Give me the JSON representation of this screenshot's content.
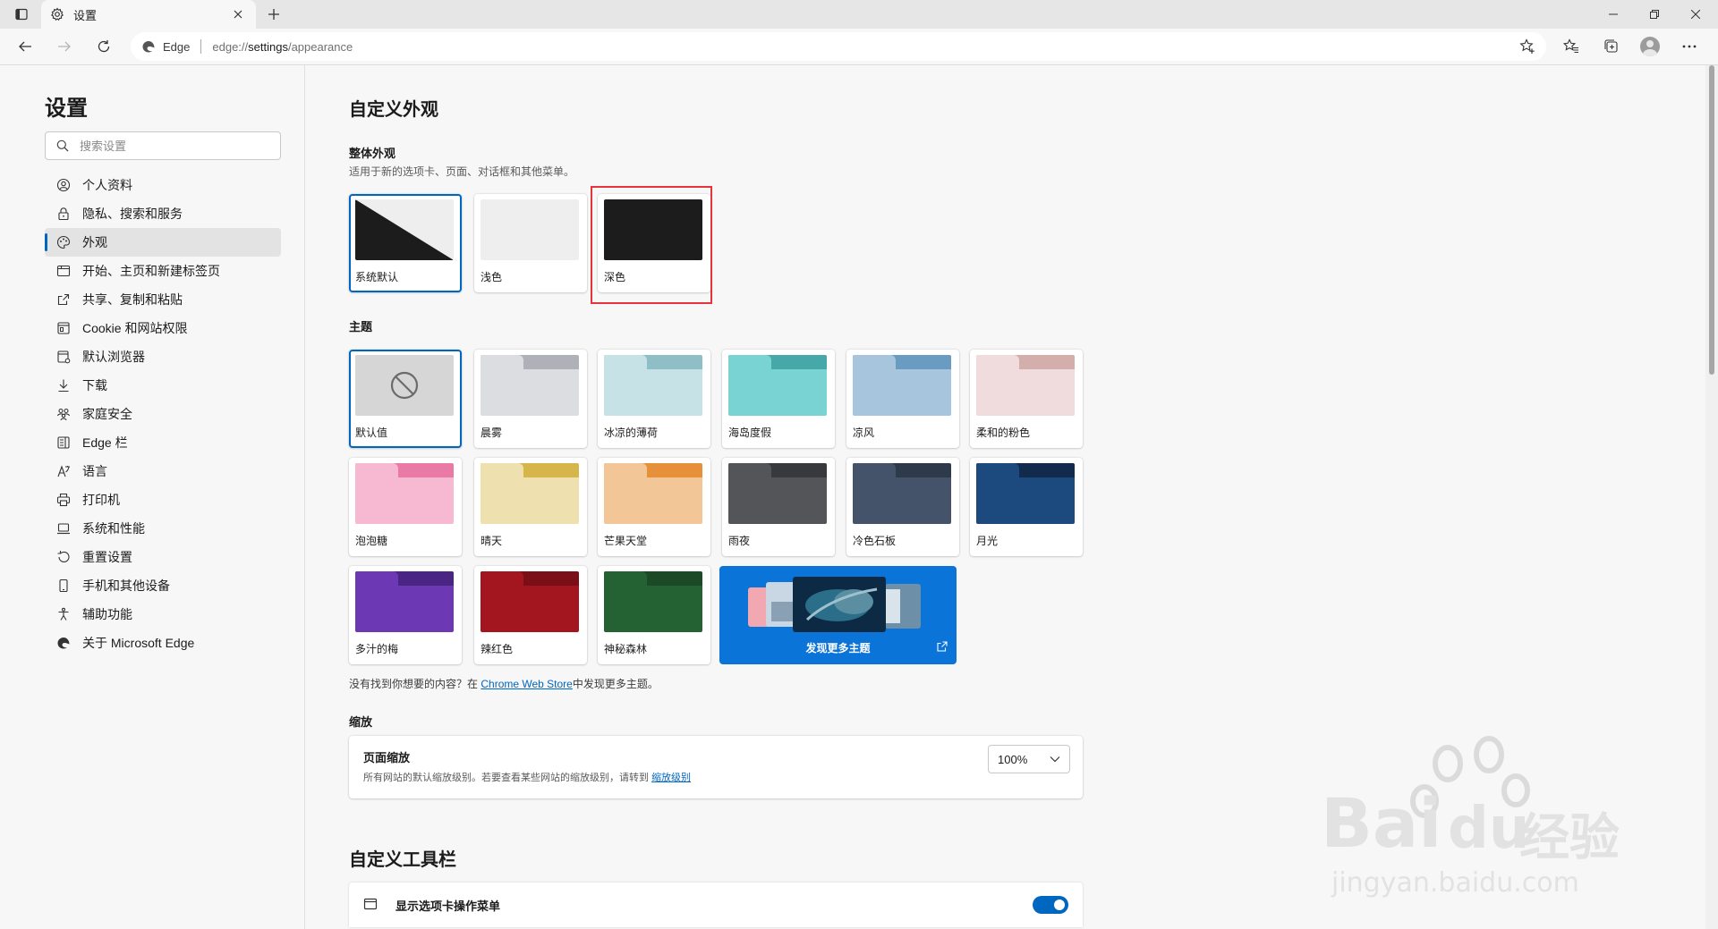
{
  "browser": {
    "tab_title": "设置",
    "site_label": "Edge",
    "url_prefix": "edge://",
    "url_main": "settings",
    "url_suffix": "/appearance"
  },
  "sidebar": {
    "title": "设置",
    "search_placeholder": "搜索设置",
    "items": [
      {
        "label": "个人资料",
        "icon": "profile-icon"
      },
      {
        "label": "隐私、搜索和服务",
        "icon": "lock-icon"
      },
      {
        "label": "外观",
        "icon": "appearance-icon",
        "active": true
      },
      {
        "label": "开始、主页和新建标签页",
        "icon": "home-tab-icon"
      },
      {
        "label": "共享、复制和粘贴",
        "icon": "share-icon"
      },
      {
        "label": "Cookie 和网站权限",
        "icon": "cookie-icon"
      },
      {
        "label": "默认浏览器",
        "icon": "browser-icon"
      },
      {
        "label": "下载",
        "icon": "download-icon"
      },
      {
        "label": "家庭安全",
        "icon": "family-icon"
      },
      {
        "label": "Edge 栏",
        "icon": "edge-bar-icon"
      },
      {
        "label": "语言",
        "icon": "language-icon"
      },
      {
        "label": "打印机",
        "icon": "printer-icon"
      },
      {
        "label": "系统和性能",
        "icon": "laptop-icon"
      },
      {
        "label": "重置设置",
        "icon": "reset-icon"
      },
      {
        "label": "手机和其他设备",
        "icon": "phone-icon"
      },
      {
        "label": "辅助功能",
        "icon": "accessibility-icon"
      },
      {
        "label": "关于 Microsoft Edge",
        "icon": "edge-logo-icon"
      }
    ]
  },
  "main": {
    "heading": "自定义外观",
    "overall": {
      "label": "整体外观",
      "description": "适用于新的选项卡、页面、对话框和其他菜单。",
      "options": [
        {
          "label": "系统默认",
          "selected": true
        },
        {
          "label": "浅色"
        },
        {
          "label": "深色",
          "highlighted": true
        }
      ]
    },
    "themes": {
      "label": "主题",
      "items": [
        {
          "label": "默认值",
          "selected": true,
          "tab": "#c9c9c9",
          "body": "#d6d6d6"
        },
        {
          "label": "晨雾",
          "tab": "#aeb2b8",
          "body": "#dcdde0"
        },
        {
          "label": "冰凉的薄荷",
          "tab": "#8fbec6",
          "body": "#c7e2e6"
        },
        {
          "label": "海岛度假",
          "tab": "#46a8a8",
          "body": "#7ad3d3"
        },
        {
          "label": "凉风",
          "tab": "#6a9bc0",
          "body": "#a7c6de"
        },
        {
          "label": "柔和的粉色",
          "tab": "#d4aeaa",
          "body": "#f0dcdc"
        },
        {
          "label": "泡泡糖",
          "tab": "#e87aa5",
          "body": "#f6b9d1"
        },
        {
          "label": "晴天",
          "tab": "#d6b54a",
          "body": "#efe0b0"
        },
        {
          "label": "芒果天堂",
          "tab": "#e6913a",
          "body": "#f3c698"
        },
        {
          "label": "雨夜",
          "tab": "#38393c",
          "body": "#545558"
        },
        {
          "label": "冷色石板",
          "tab": "#2e3a4c",
          "body": "#45536a"
        },
        {
          "label": "月光",
          "tab": "#122a4c",
          "body": "#1d4a7e"
        },
        {
          "label": "多汁的梅",
          "tab": "#4a2584",
          "body": "#6c38b3"
        },
        {
          "label": "辣红色",
          "tab": "#7a0f17",
          "body": "#a3151f"
        },
        {
          "label": "神秘森林",
          "tab": "#1c4a26",
          "body": "#246233"
        }
      ],
      "discover_label": "发现更多主题"
    },
    "store_note_prefix": "没有找到你想要的内容？在",
    "store_link": "Chrome Web Store",
    "store_note_suffix": "中发现更多主题。",
    "zoom_section": "缩放",
    "zoom": {
      "title": "页面缩放",
      "description": "所有网站的默认缩放级别。若要查看某些网站的缩放级别，请转到",
      "link": "缩放级别",
      "value": "100%"
    },
    "toolbar_heading": "自定义工具栏",
    "toggle": {
      "label": "显示选项卡操作菜单",
      "on": true
    }
  },
  "watermark": {
    "brand_left": "Bai",
    "brand_right": "du",
    "brand_cn": "经验",
    "domain": "jingyan.baidu.com"
  },
  "colors": {
    "accent": "#0067c0",
    "highlight": "#e8333a",
    "discover": "#0a74d9"
  }
}
